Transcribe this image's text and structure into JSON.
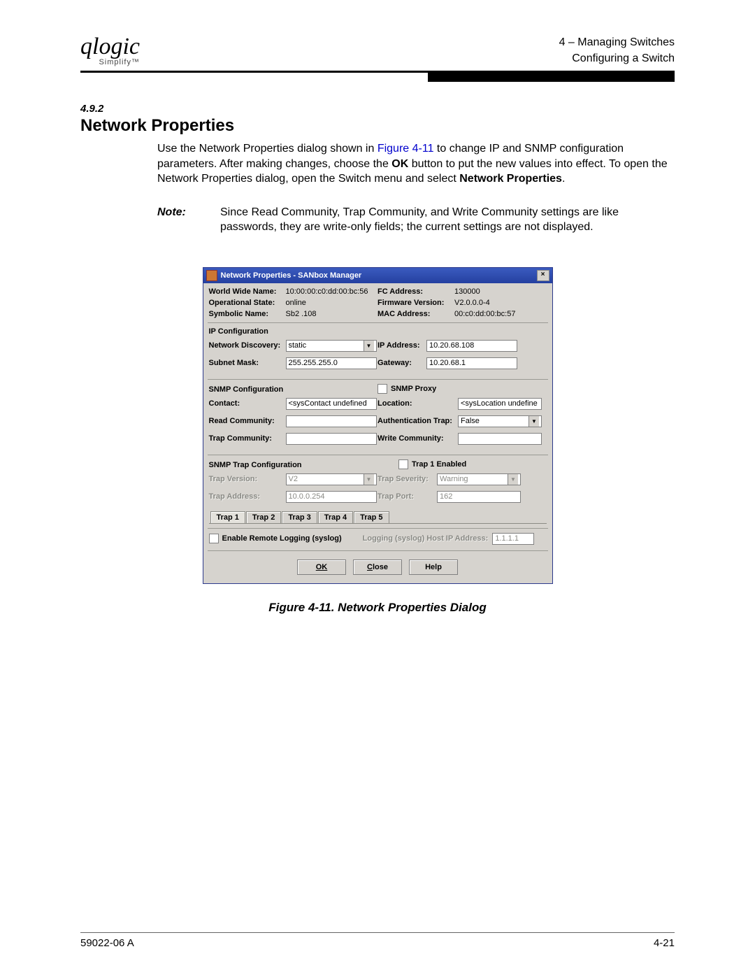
{
  "header": {
    "logo_text": "qlogic",
    "logo_sub": "Simplify™",
    "chapter": "4 – Managing Switches",
    "section": "Configuring a Switch"
  },
  "section_no": "4.9.2",
  "section_title": "Network Properties",
  "para_1a": "Use the Network Properties dialog shown in ",
  "figref": "Figure 4-11",
  "para_1b": " to change IP and SNMP configuration parameters. After making changes, choose the ",
  "para_1c": "OK",
  "para_1d": " button to put the new values into effect. To open the Network Properties dialog, open the Switch menu and select ",
  "para_1e": "Network Properties",
  "para_1f": ".",
  "note_label": "Note:",
  "note_text": "Since Read Community, Trap Community, and Write Community settings are like passwords, they are write-only fields; the current settings are not displayed.",
  "dialog": {
    "title": "Network Properties - SANbox Manager",
    "close": "×",
    "info": {
      "wwn_label": "World Wide Name:",
      "wwn": "10:00:00:c0:dd:00:bc:56",
      "fc_label": "FC Address:",
      "fc": "130000",
      "op_label": "Operational State:",
      "op": "online",
      "fw_label": "Firmware Version:",
      "fw": "V2.0.0.0-4",
      "sym_label": "Symbolic Name:",
      "sym": "Sb2 .108",
      "mac_label": "MAC Address:",
      "mac": "00:c0:dd:00:bc:57"
    },
    "ipconf": {
      "title": "IP Configuration",
      "disc_label": "Network Discovery:",
      "disc": "static",
      "ip_label": "IP Address:",
      "ip": "10.20.68.108",
      "mask_label": "Subnet Mask:",
      "mask": "255.255.255.0",
      "gw_label": "Gateway:",
      "gw": "10.20.68.1"
    },
    "snmp": {
      "title": "SNMP Configuration",
      "proxy_label": "SNMP Proxy",
      "contact_label": "Contact:",
      "contact": "<sysContact undefined",
      "location_label": "Location:",
      "location": "<sysLocation undefine",
      "read_label": "Read Community:",
      "read": "",
      "auth_label": "Authentication Trap:",
      "auth": "False",
      "trapc_label": "Trap Community:",
      "trapc": "",
      "write_label": "Write Community:",
      "write": ""
    },
    "trap": {
      "title": "SNMP Trap Configuration",
      "enabled_label": "Trap 1 Enabled",
      "ver_label": "Trap Version:",
      "ver": "V2",
      "sev_label": "Trap Severity:",
      "sev": "Warning",
      "addr_label": "Trap Address:",
      "addr": "10.0.0.254",
      "port_label": "Trap Port:",
      "port": "162"
    },
    "tabs": [
      "Trap 1",
      "Trap 2",
      "Trap 3",
      "Trap 4",
      "Trap 5"
    ],
    "logging": {
      "enable_label": "Enable Remote Logging (syslog)",
      "host_label": "Logging (syslog) Host IP Address:",
      "host": "1.1.1.1"
    },
    "buttons": {
      "ok": "OK",
      "close": "Close",
      "help": "Help"
    }
  },
  "caption": "Figure 4-11.  Network Properties Dialog",
  "footer": {
    "left": "59022-06  A",
    "right": "4-21"
  }
}
